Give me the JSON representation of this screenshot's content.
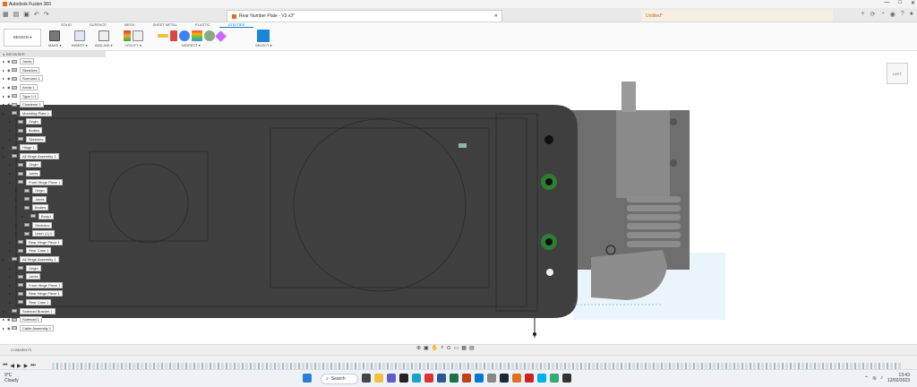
{
  "window": {
    "title": "Autodesk Fusion 360",
    "controls": [
      "—",
      "□",
      "✕"
    ]
  },
  "document_tab": {
    "title": "Rear Number Plate - V3 v3*",
    "close": "✕"
  },
  "second_tab": {
    "title": "Untitled*"
  },
  "ribbon": {
    "tabs": [
      "SOLID",
      "SURFACE",
      "MESH",
      "SHEET METAL",
      "PLASTIC",
      "UTILITIES"
    ],
    "active_tab": "UTILITIES",
    "workspace": "DESIGN ▾",
    "groups": [
      "MAKE ▾",
      "INSERT ▾",
      "ADD-INS ▾",
      "UTILITY ▾",
      "INSPECT ▾",
      "SELECT ▾"
    ]
  },
  "browser": {
    "header": "BROWSER",
    "items": [
      {
        "label": "Joints",
        "indent": 0
      },
      {
        "label": "Sketches",
        "indent": 0
      },
      {
        "label": "Surround 1",
        "indent": 0
      },
      {
        "label": "Arrow 1",
        "indent": 0
      },
      {
        "label": "Type 1:1",
        "indent": 0
      },
      {
        "label": "Chadenor 1",
        "indent": 0
      },
      {
        "label": "Mounting Plate 1",
        "indent": 0
      },
      {
        "label": "Origin",
        "indent": 1
      },
      {
        "label": "Bodies",
        "indent": 1
      },
      {
        "label": "Sketches",
        "indent": 1
      },
      {
        "label": "Hinge 1",
        "indent": 0
      },
      {
        "label": "All Hinge Assembly 1",
        "indent": 0
      },
      {
        "label": "Origin",
        "indent": 1
      },
      {
        "label": "Joints",
        "indent": 1
      },
      {
        "label": "Front Hinge Piece 1",
        "indent": 1
      },
      {
        "label": "Origin",
        "indent": 2
      },
      {
        "label": "Joints",
        "indent": 2
      },
      {
        "label": "Bodies",
        "indent": 2
      },
      {
        "label": "Body1",
        "indent": 3
      },
      {
        "label": "Sketches",
        "indent": 2
      },
      {
        "label": "Latch (1):1",
        "indent": 2
      },
      {
        "label": "Rear Hinge Piece 1",
        "indent": 1
      },
      {
        "label": "Rear Case 1",
        "indent": 1
      },
      {
        "label": "All Hinge Assembly 1",
        "indent": 0
      },
      {
        "label": "Origin",
        "indent": 1
      },
      {
        "label": "Joints",
        "indent": 1
      },
      {
        "label": "Front Hinge Piece 1",
        "indent": 1
      },
      {
        "label": "Rear Hinge Piece 1",
        "indent": 1
      },
      {
        "label": "Rear Case 1",
        "indent": 1
      },
      {
        "label": "Solenoid Bracket 1",
        "indent": 0
      },
      {
        "label": "Solenoid 1",
        "indent": 0
      },
      {
        "label": "Cable Assembly 1",
        "indent": 0
      }
    ]
  },
  "navcube": {
    "label": "LEFT"
  },
  "comments": {
    "label": "COMMENTS"
  },
  "taskbar": {
    "weather_temp": "9°C",
    "weather_desc": "Cloudy",
    "search": "Search",
    "time": "13:43",
    "date": "12/02/2023"
  },
  "colors": {
    "accent": "#0a7ad6",
    "plate": "#3f3f3f",
    "green_ring": "#2e7d32"
  }
}
